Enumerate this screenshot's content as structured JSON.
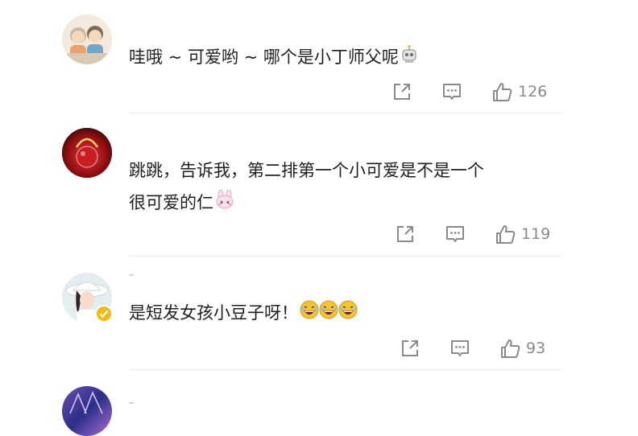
{
  "comments": [
    {
      "text": "哇哦 ~ 可爱哟 ~ 哪个是小丁师父呢",
      "emoji": "robot-emoji",
      "likes": "126"
    },
    {
      "text_line1": "跳跳，告诉我，第二排第一个小可爱是不是一个",
      "text_line2": "很可爱的仁",
      "emoji": "bunny-emoji",
      "likes": "119"
    },
    {
      "text": "是短发女孩小豆子呀！",
      "emoji": "laughing-emoji",
      "likes": "93",
      "verified": true
    }
  ],
  "colors": {
    "icon": "#8a8a8a",
    "divider": "#ececec",
    "verified": "#f5b915"
  }
}
